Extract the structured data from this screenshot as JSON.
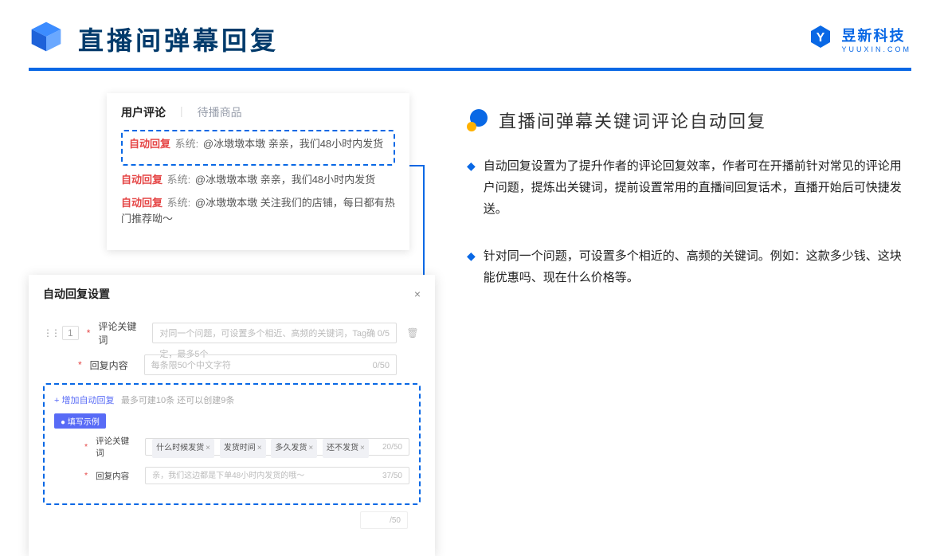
{
  "header": {
    "title": "直播间弹幕回复",
    "brand_name": "昱新科技",
    "brand_sub": "YUUXIN.COM"
  },
  "comments": {
    "tab_active": "用户评论",
    "tab_inactive": "待播商品",
    "highlight_auto": "自动回复",
    "highlight_sys": "系统:",
    "highlight_text": "@冰墩墩本墩 亲亲，我们48小时内发货",
    "item2_text": "@冰墩墩本墩 亲亲，我们48小时内发货",
    "item3_text": "@冰墩墩本墩 关注我们的店铺，每日都有热门推荐呦～"
  },
  "settings": {
    "title": "自动回复设置",
    "close": "×",
    "idx": "1",
    "label_keyword": "评论关键词",
    "placeholder_keyword": "对同一个问题，可设置多个相近、高频的关键词，Tag确定，最多5个",
    "count_keyword": "0/5",
    "label_reply": "回复内容",
    "placeholder_reply": "每条限50个中文字符",
    "count_reply": "0/50",
    "add_link": "+ 增加自动回复",
    "add_hint": "最多可建10条 还可以创建9条",
    "pill": "● 填写示例",
    "ex_kw_label": "评论关键词",
    "ex_chip1": "什么时候发货",
    "ex_chip2": "发货时间",
    "ex_chip3": "多久发货",
    "ex_chip4": "还不发货",
    "ex_kw_count": "20/50",
    "ex_reply_label": "回复内容",
    "ex_reply_value": "亲，我们这边都是下单48小时内发货的哦～",
    "ex_reply_count": "37/50",
    "ghost_count": "/50"
  },
  "right": {
    "section_title": "直播间弹幕关键词评论自动回复",
    "bullet1": "自动回复设置为了提升作者的评论回复效率，作者可在开播前针对常见的评论用户问题，提炼出关键词，提前设置常用的直播间回复话术，直播开始后可快捷发送。",
    "bullet2": "针对同一个问题，可设置多个相近的、高频的关键词。例如：这款多少钱、这块能优惠吗、现在什么价格等。"
  }
}
